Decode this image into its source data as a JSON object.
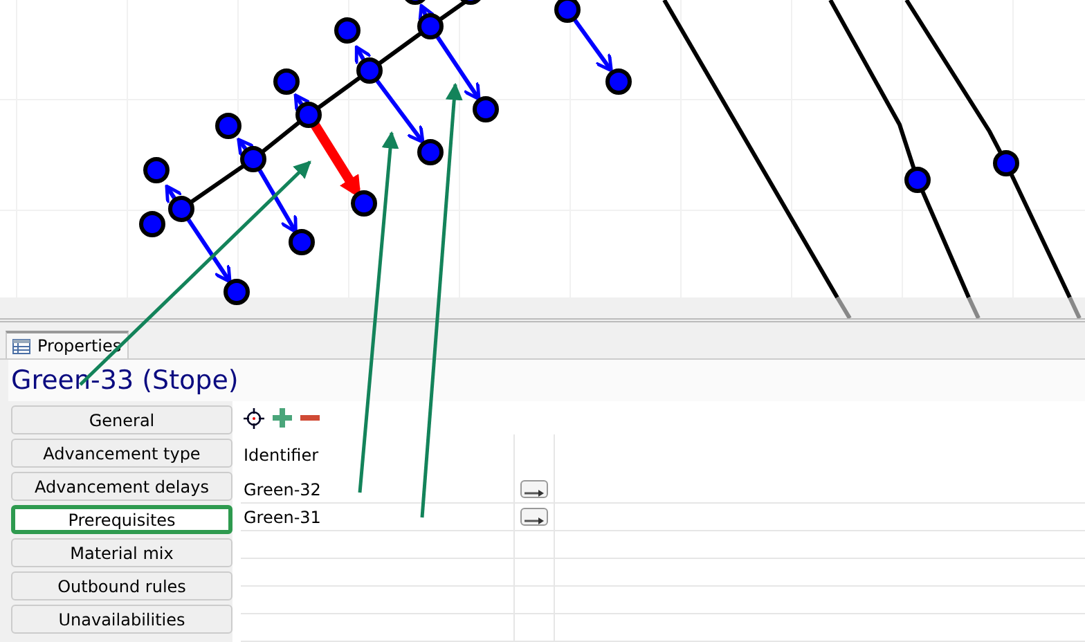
{
  "panel_tab": {
    "label": "Properties",
    "selected": true
  },
  "title": "Green-33 (Stope)",
  "sections": [
    {
      "label": "General",
      "selected": false
    },
    {
      "label": "Advancement type",
      "selected": false
    },
    {
      "label": "Advancement delays",
      "selected": false
    },
    {
      "label": "Prerequisites",
      "selected": true
    },
    {
      "label": "Material mix",
      "selected": false
    },
    {
      "label": "Outbound rules",
      "selected": false
    },
    {
      "label": "Unavailabilities",
      "selected": false
    }
  ],
  "table": {
    "columns": [
      "Identifier"
    ],
    "rows": [
      {
        "identifier": "Green-32"
      },
      {
        "identifier": "Green-31"
      }
    ]
  }
}
